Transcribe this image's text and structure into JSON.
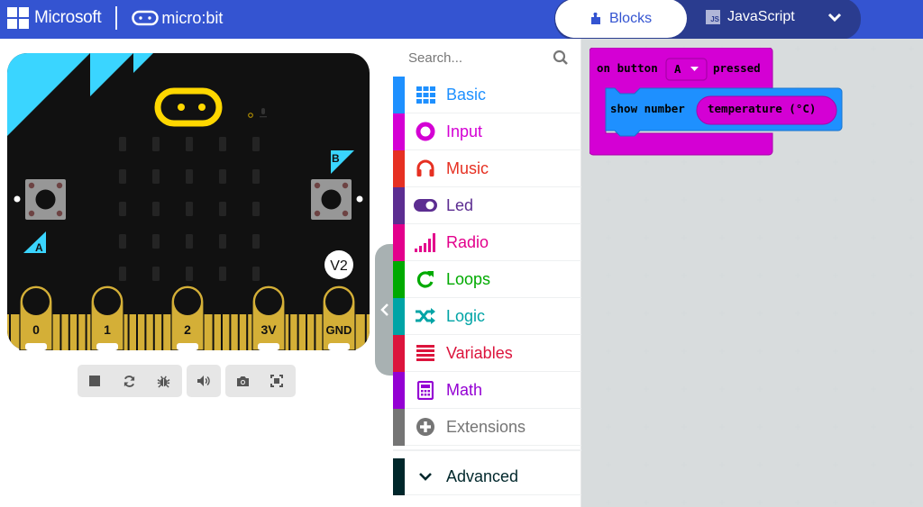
{
  "header": {
    "brand": "Microsoft",
    "product": "micro:bit",
    "tabs": [
      {
        "label": "Blocks",
        "icon": "puzzle-icon",
        "active": true
      },
      {
        "label": "JavaScript",
        "icon": "js-icon",
        "badge": "JS",
        "active": false
      }
    ],
    "more_icon": "chevron-down-icon"
  },
  "simulator": {
    "version_badge": "V2",
    "button_labels": [
      "A",
      "B"
    ],
    "pins": [
      "0",
      "1",
      "2",
      "3V",
      "GND"
    ],
    "led_matrix": {
      "rows": 5,
      "cols": 5,
      "lit": []
    },
    "controls": [
      {
        "name": "stop",
        "icon": "stop-icon"
      },
      {
        "name": "restart",
        "icon": "restart-icon"
      },
      {
        "name": "debug",
        "icon": "bug-icon"
      },
      {
        "name": "mute",
        "icon": "volume-icon"
      },
      {
        "name": "screenshot",
        "icon": "camera-icon"
      },
      {
        "name": "fullscreen",
        "icon": "fullscreen-icon"
      }
    ]
  },
  "toolbox": {
    "search_placeholder": "Search...",
    "categories": [
      {
        "label": "Basic",
        "color": "#1e90ff",
        "icon": "grid-icon"
      },
      {
        "label": "Input",
        "color": "#d400d4",
        "icon": "target-icon"
      },
      {
        "label": "Music",
        "color": "#e63022",
        "icon": "headphones-icon"
      },
      {
        "label": "Led",
        "color": "#5c2d91",
        "icon": "toggle-icon"
      },
      {
        "label": "Radio",
        "color": "#e3008c",
        "icon": "signal-icon"
      },
      {
        "label": "Loops",
        "color": "#00aa00",
        "icon": "loop-icon"
      },
      {
        "label": "Logic",
        "color": "#00a4a6",
        "icon": "shuffle-icon"
      },
      {
        "label": "Variables",
        "color": "#dc143c",
        "icon": "list-icon"
      },
      {
        "label": "Math",
        "color": "#9400d3",
        "icon": "calculator-icon"
      },
      {
        "label": "Extensions",
        "color": "#757575",
        "icon": "plus-circle-icon"
      }
    ],
    "advanced": {
      "label": "Advanced",
      "color": "#00272b",
      "icon": "chevron-down-icon"
    }
  },
  "workspace": {
    "event_block": {
      "prefix": "on button",
      "dropdown_value": "A",
      "suffix": "pressed",
      "color": "#d400d4"
    },
    "statement_block": {
      "label": "show number",
      "color": "#1e90ff"
    },
    "reporter_block": {
      "label": "temperature (°C)",
      "color": "#d400d4"
    }
  }
}
